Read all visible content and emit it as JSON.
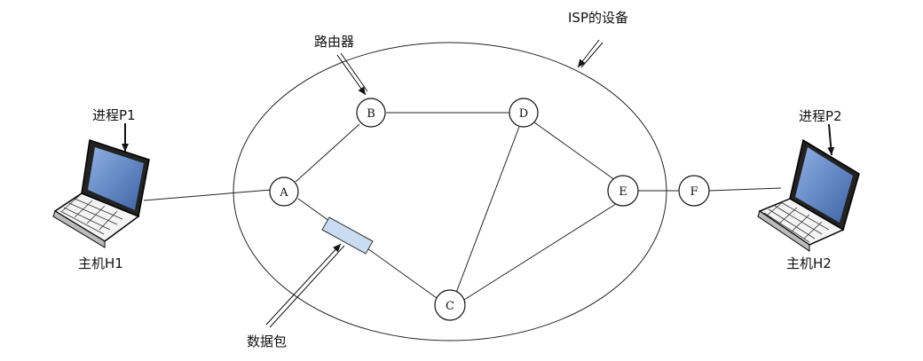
{
  "diagram": {
    "labels": {
      "isp_equipment": "ISP的设备",
      "router": "路由器",
      "process_p1": "进程P1",
      "process_p2": "进程P2",
      "host_h1": "主机H1",
      "host_h2": "主机H2",
      "packet": "数据包"
    },
    "nodes": [
      {
        "id": "A",
        "label": "A"
      },
      {
        "id": "B",
        "label": "B"
      },
      {
        "id": "C",
        "label": "C"
      },
      {
        "id": "D",
        "label": "D"
      },
      {
        "id": "E",
        "label": "E"
      },
      {
        "id": "F",
        "label": "F"
      }
    ],
    "links": [
      [
        "H1",
        "A"
      ],
      [
        "A",
        "B"
      ],
      [
        "A",
        "C"
      ],
      [
        "B",
        "D"
      ],
      [
        "D",
        "C"
      ],
      [
        "D",
        "E"
      ],
      [
        "C",
        "E"
      ],
      [
        "E",
        "F"
      ],
      [
        "F",
        "H2"
      ]
    ],
    "colors": {
      "line": "#222222",
      "screen": "#5b7fbf",
      "packet": "#c9dcf2"
    }
  }
}
